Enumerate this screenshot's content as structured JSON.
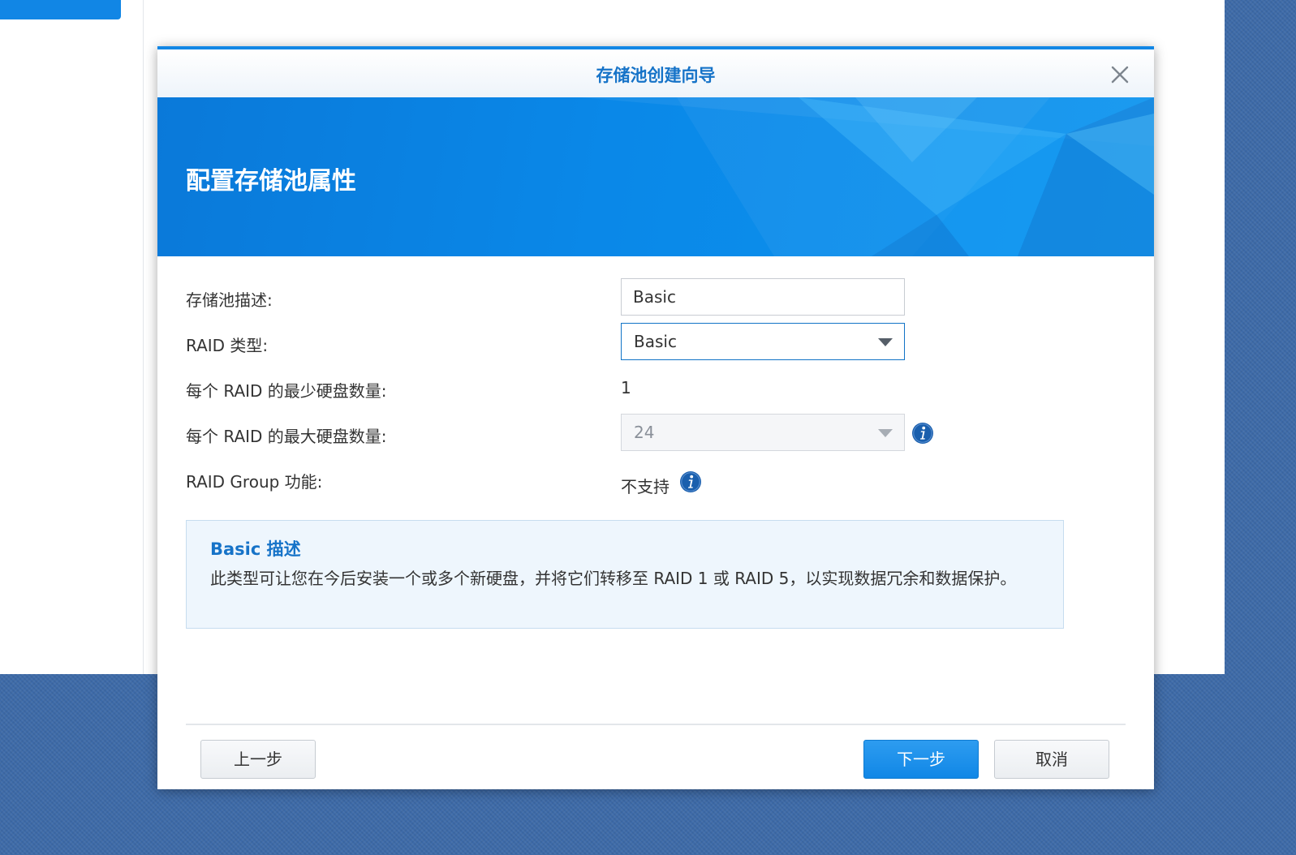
{
  "dialog": {
    "title": "存储池创建向导",
    "banner_title": "配置存储池属性"
  },
  "form": {
    "description": {
      "label": "存储池描述:",
      "value": "Basic"
    },
    "raid_type": {
      "label": "RAID 类型:",
      "value": "Basic"
    },
    "min_disks": {
      "label": "每个 RAID 的最少硬盘数量:",
      "value": "1"
    },
    "max_disks": {
      "label": "每个 RAID 的最大硬盘数量:",
      "value": "24"
    },
    "raid_group": {
      "label": "RAID Group 功能:",
      "value": "不支持"
    }
  },
  "info_box": {
    "title": "Basic 描述",
    "text": "此类型可让您在今后安装一个或多个新硬盘，并将它们转移至 RAID 1 或 RAID 5，以实现数据冗余和数据保护。"
  },
  "buttons": {
    "back": "上一步",
    "next": "下一步",
    "cancel": "取消"
  },
  "colors": {
    "accent": "#1186e5",
    "title_blue": "#1673c8",
    "desktop": "#3d6aa8",
    "info_icon": "#1a5fad"
  },
  "icons": {
    "close": "close-icon",
    "info": "info-icon",
    "dropdown": "chevron-down-icon"
  }
}
